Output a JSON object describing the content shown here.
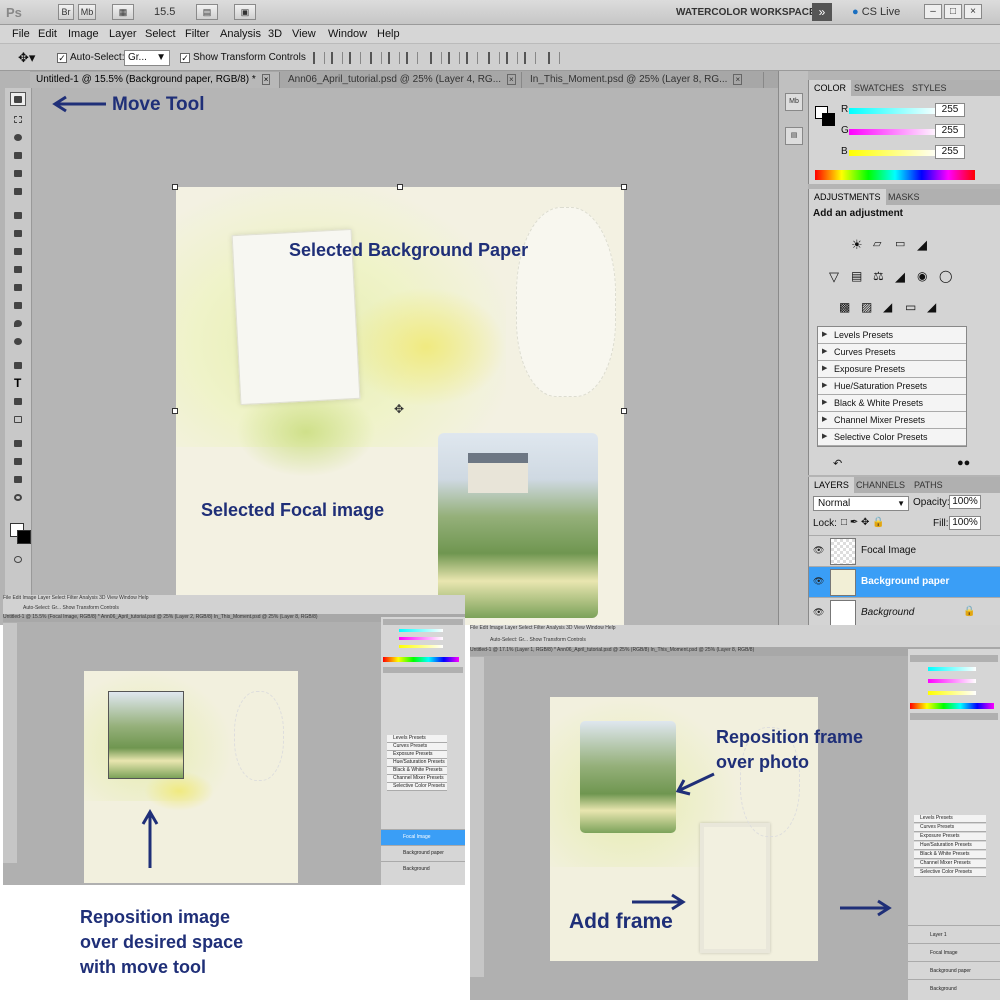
{
  "app": {
    "logo": "Ps",
    "buttons": [
      "Br",
      "Mb"
    ],
    "zoom": "15.5",
    "workspace": "WATERCOLOR WORKSPACE",
    "cs_live": "CS Live"
  },
  "menu": [
    "File",
    "Edit",
    "Image",
    "Layer",
    "Select",
    "Filter",
    "Analysis",
    "3D",
    "View",
    "Window",
    "Help"
  ],
  "options": {
    "auto_select_label": "Auto-Select:",
    "auto_select_value": "Gr...",
    "show_transform_label": "Show Transform Controls"
  },
  "tabs": [
    {
      "title": "Untitled-1 @ 15.5% (Background paper, RGB/8) *"
    },
    {
      "title": "Ann06_April_tutorial.psd @ 25% (Layer 4, RG..."
    },
    {
      "title": "In_This_Moment.psd @ 25% (Layer 8, RG..."
    }
  ],
  "color_panel": {
    "tabs": [
      "COLOR",
      "SWATCHES",
      "STYLES"
    ],
    "channels": [
      {
        "name": "R",
        "value": "255"
      },
      {
        "name": "G",
        "value": "255"
      },
      {
        "name": "B",
        "value": "255"
      }
    ]
  },
  "adjustments": {
    "tabs": [
      "ADJUSTMENTS",
      "MASKS"
    ],
    "heading": "Add an adjustment",
    "presets": [
      "Levels Presets",
      "Curves Presets",
      "Exposure Presets",
      "Hue/Saturation Presets",
      "Black & White Presets",
      "Channel Mixer Presets",
      "Selective Color Presets"
    ]
  },
  "layers_panel": {
    "tabs": [
      "LAYERS",
      "CHANNELS",
      "PATHS"
    ],
    "blend_mode": "Normal",
    "opacity_label": "Opacity:",
    "opacity": "100%",
    "lock_label": "Lock:",
    "fill_label": "Fill:",
    "fill": "100%",
    "layers": [
      "Focal Image",
      "Background paper",
      "Background"
    ]
  },
  "annotations": {
    "move_tool": "Move Tool",
    "selected_bg": "Selected Background Paper",
    "selected_focal": "Selected Focal image",
    "reposition_image": [
      "Reposition image",
      "over desired space",
      "with move tool"
    ],
    "reposition_frame": [
      "Reposition frame",
      "over photo"
    ],
    "add_frame": "Add frame"
  },
  "mini_left": {
    "menu": "File  Edit  Image  Layer  Select  Filter  Analysis  3D  View  Window  Help",
    "options": "Auto-Select:  Gr...  Show Transform Controls",
    "tabs": "Untitled-1 @ 15.5% (Focal Image, RGB/8) *     Ann06_April_tutorial.psd @ 25% (Layer 2, RGB/8)     In_This_Moment.psd @ 25% (Layer 8, RGB/8)",
    "layers": [
      "Focal Image",
      "Background paper",
      "Background"
    ]
  },
  "mini_right": {
    "menu": "File  Edit  Image  Layer  Select  Filter  Analysis  3D  View  Window  Help",
    "options": "Auto-Select:  Gr...  Show Transform Controls",
    "tabs": "Untitled-1 @ 17.1% (Layer 1, RGB/8) *     Ann06_April_tutorial.psd @ 25% (RGB/8)     In_This_Moment.psd @ 25% (Layer 8, RGB/8)",
    "layers": [
      "Layer 1",
      "Focal Image",
      "Background paper",
      "Background"
    ]
  },
  "colors": {
    "label": "#1f2f78",
    "selection": "#3a9ef6",
    "canvas": "#b5b5b5"
  }
}
